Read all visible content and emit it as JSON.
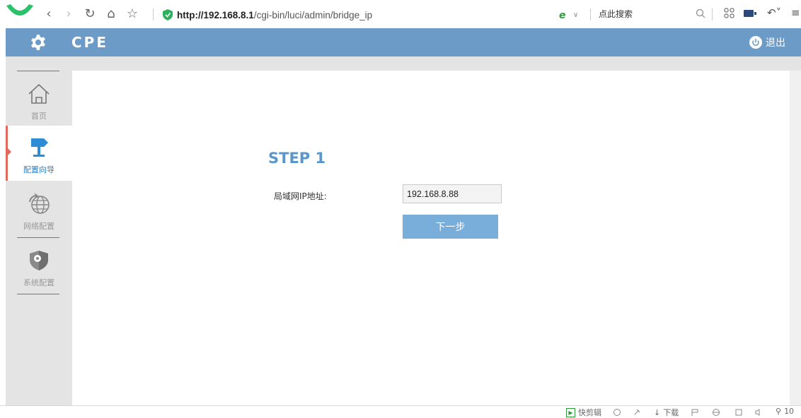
{
  "browser": {
    "url_host": "http://192.168.8.1",
    "url_path": "/cgi-bin/luci/admin/bridge_ip",
    "search_label": "点此搜索"
  },
  "app": {
    "title": "CPE",
    "logout_label": "退出"
  },
  "sidebar": {
    "items": [
      {
        "label": "首页",
        "icon": "home-icon",
        "active": false
      },
      {
        "label": "配置向导",
        "icon": "signpost-icon",
        "active": true
      },
      {
        "label": "网络配置",
        "icon": "globe-icon",
        "active": false
      },
      {
        "label": "系统配置",
        "icon": "shield-gear-icon",
        "active": false
      }
    ]
  },
  "main": {
    "step_title": "STEP 1",
    "lan_ip_label": "局域网IP地址:",
    "lan_ip_value": "192.168.8.88",
    "next_button": "下一步"
  },
  "statusbar": {
    "quickcut_label": "快剪辑",
    "download_label": "下载",
    "zoom_label": "10"
  },
  "colors": {
    "header_bg": "#6b9bc6",
    "step_title": "#5b96cb",
    "button_bg": "#79aedb",
    "active_indicator": "#e26a5d",
    "sidebar_bg": "#e4e4e4"
  }
}
